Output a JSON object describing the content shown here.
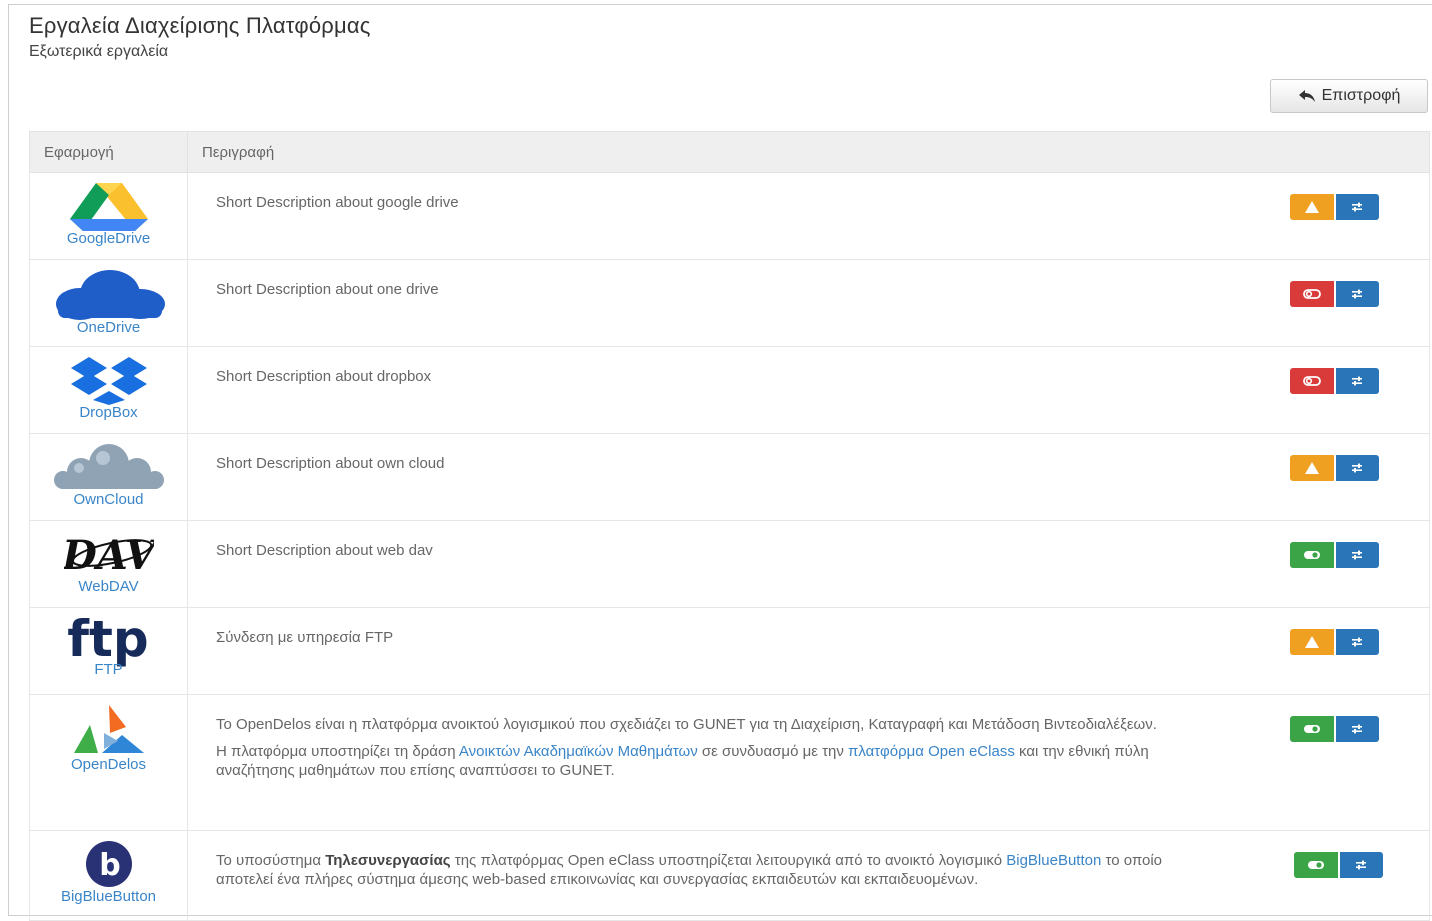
{
  "header": {
    "title": "Εργαλεία Διαχείρισης Πλατφόρμας",
    "subtitle": "Εξωτερικά εργαλεία",
    "back_label": "Επιστροφή"
  },
  "table": {
    "columns": [
      "Εφαρμογή",
      "Περιγραφή"
    ],
    "rows": [
      {
        "app": "GoogleDrive",
        "description": "Short Description about google drive",
        "status": "warning"
      },
      {
        "app": "OneDrive",
        "description": "Short Description about one drive",
        "status": "disabled"
      },
      {
        "app": "DropBox",
        "description": "Short Description about dropbox",
        "status": "disabled"
      },
      {
        "app": "OwnCloud",
        "description": "Short Description about own cloud",
        "status": "warning"
      },
      {
        "app": "WebDAV",
        "description": "Short Description about web dav",
        "status": "enabled"
      },
      {
        "app": "FTP",
        "description": "Σύνδεση με υπηρεσία FTP",
        "status": "warning"
      },
      {
        "app": "OpenDelos",
        "description": "Το OpenDelos είναι η πλατφόρμα ανοικτού λογισμικού που σχεδιάζει το GUNET για τη Διαχείριση, Καταγραφή και Μετάδοση Βιντεοδιαλέξεων.",
        "description2_a": "Η πλατφόρμα υποστηρίζει τη δράση ",
        "description2_link1": "Ανοικτών Ακαδημαϊκών Μαθημάτων",
        "description2_b": " σε συνδυασμό με την ",
        "description2_link2": "πλατφόρμα Open eClass",
        "description2_c": " και την εθνική πύλη αναζήτησης μαθημάτων που επίσης αναπτύσσει το GUNET.",
        "status": "enabled"
      },
      {
        "app": "BigBlueButton",
        "description_a": "Το υποσύστημα ",
        "description_bold": "Τηλεσυνεργασίας",
        "description_b": " της πλατφόρμας Open eClass υποστηρίζεται λειτουργικά από το ανοικτό λογισμικό ",
        "description_link": "BigBlueButton",
        "description_c": " το οποίο αποτελεί ένα πλήρες σύστημα άμεσης web-based επικοινωνίας και συνεργασίας εκπαιδευτών και εκπαιδευομένων.",
        "status": "enabled"
      }
    ]
  },
  "colors": {
    "warning": "#f0a020",
    "disabled": "#d93a3a",
    "enabled": "#3aa447",
    "config": "#2a75b8",
    "link": "#3a85c8"
  },
  "icons": {
    "back": "undo-arrow-icon",
    "warning": "warning-triangle-icon",
    "disabled": "toggle-off-icon",
    "enabled": "toggle-on-icon",
    "config": "sliders-icon"
  }
}
